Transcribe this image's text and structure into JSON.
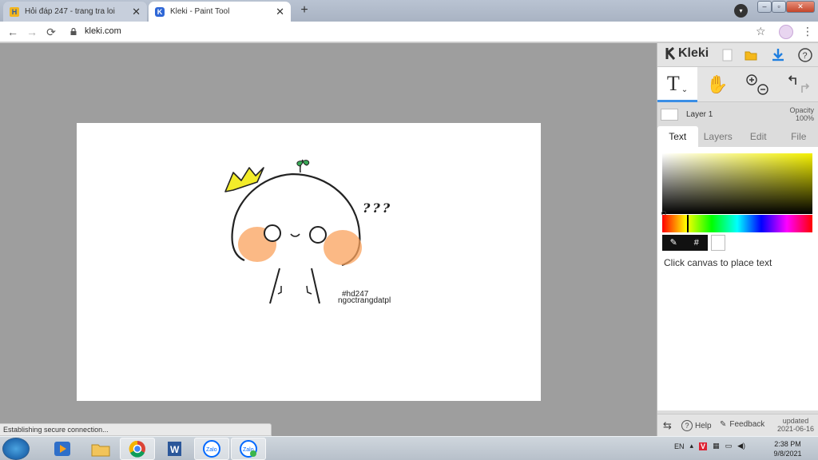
{
  "browser": {
    "tabs": [
      {
        "title": "Hỏi đáp 247 - trang tra loi",
        "icon": "site-h-icon"
      },
      {
        "title": "Kleki - Paint Tool",
        "icon": "kleki-icon"
      }
    ],
    "url": "kleki.com",
    "status_text": "Establishing secure connection..."
  },
  "kleki": {
    "logo": "Kleki",
    "layer_name": "Layer 1",
    "opacity_label": "Opacity",
    "opacity_value": "100%",
    "panel_tabs": [
      "Text",
      "Layers",
      "Edit",
      "File"
    ],
    "active_tab": "Text",
    "hex_symbol": "#",
    "hint": "Click canvas to place text",
    "bottom": {
      "help": "Help",
      "feedback": "Feedback",
      "updated_label": "updated",
      "updated_date": "2021-06-16"
    },
    "colors": {
      "accent": "#3a8ee6",
      "hue_start": "#ff0000",
      "sv_top": "#f4f000"
    }
  },
  "canvas": {
    "question_marks": "???",
    "watermark_1": "#hd247",
    "watermark_2": "ngoctrangdatpl"
  },
  "taskbar": {
    "lang": "EN",
    "time": "2:38 PM",
    "date": "9/8/2021"
  }
}
